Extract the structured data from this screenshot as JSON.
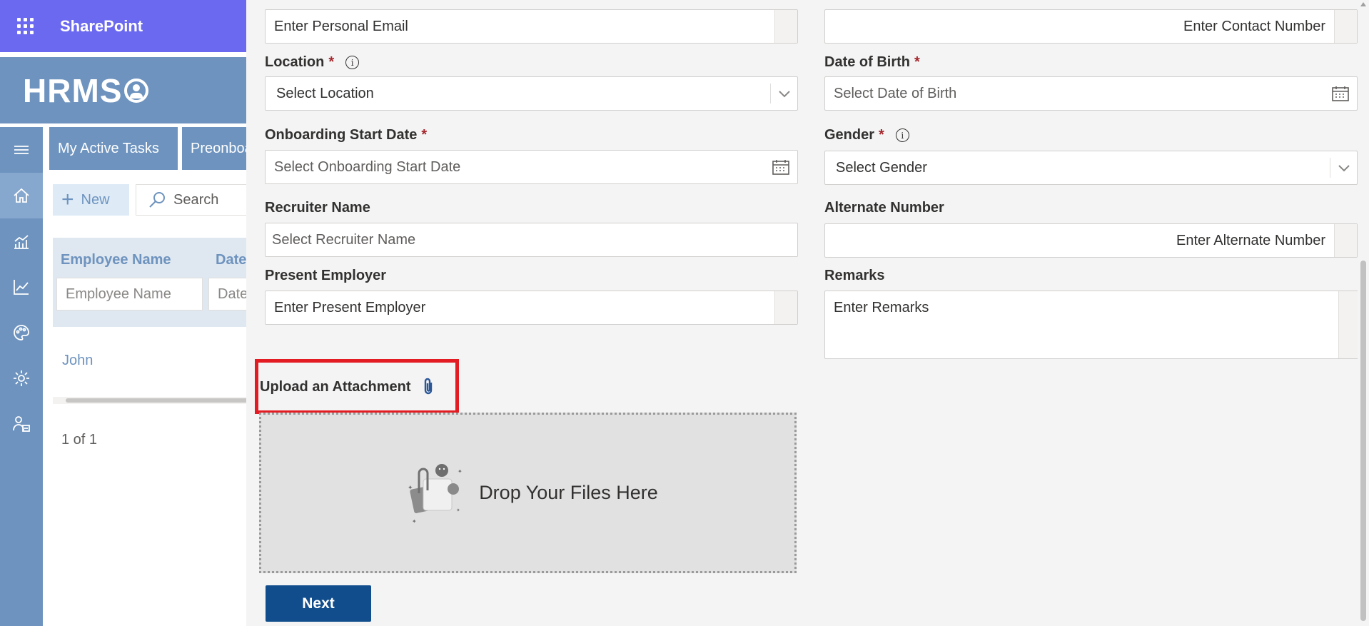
{
  "suitebar": {
    "title": "SharePoint"
  },
  "app": {
    "logo": "HRMS"
  },
  "tabs": [
    {
      "label": "My Active Tasks"
    },
    {
      "label": "Preonboarding"
    }
  ],
  "commands": {
    "new_label": "New",
    "search_placeholder": "Search"
  },
  "grid": {
    "columns": [
      {
        "label": "Employee Name"
      },
      {
        "label": "Date"
      }
    ],
    "filters": [
      {
        "placeholder": "Employee Name"
      },
      {
        "placeholder": "Date"
      }
    ],
    "rows": [
      {
        "employee_name": "John"
      }
    ],
    "pager": "1 of 1"
  },
  "form": {
    "personal_email": {
      "placeholder": "Enter Personal Email"
    },
    "contact_number": {
      "placeholder": "Enter Contact Number"
    },
    "location": {
      "label": "Location",
      "required": "*",
      "placeholder": "Select Location"
    },
    "date_of_birth": {
      "label": "Date of Birth",
      "required": "*",
      "placeholder": "Select Date of Birth"
    },
    "onboarding_start_date": {
      "label": "Onboarding Start Date",
      "required": "*",
      "placeholder": "Select Onboarding Start Date"
    },
    "gender": {
      "label": "Gender",
      "required": "*",
      "placeholder": "Select Gender"
    },
    "recruiter_name": {
      "label": "Recruiter Name",
      "placeholder": "Select Recruiter Name"
    },
    "alternate_number": {
      "label": "Alternate Number",
      "placeholder": "Enter Alternate Number"
    },
    "present_employer": {
      "label": "Present Employer",
      "placeholder": "Enter Present Employer"
    },
    "remarks": {
      "label": "Remarks",
      "placeholder": "Enter Remarks"
    },
    "upload": {
      "label": "Upload an Attachment",
      "drop_text": "Drop Your Files Here"
    },
    "next_label": "Next"
  },
  "icons": {
    "info": "info-icon",
    "calendar": "calendar-icon",
    "chevron": "chevron-down-icon",
    "attach": "paperclip-icon"
  },
  "colors": {
    "suitebar": "#6b69f0",
    "brand": "#6d93be",
    "panel_bg": "#f4f4f4",
    "primary_button": "#114d8c",
    "required": "#a4262c",
    "highlight": "#e31b23"
  }
}
